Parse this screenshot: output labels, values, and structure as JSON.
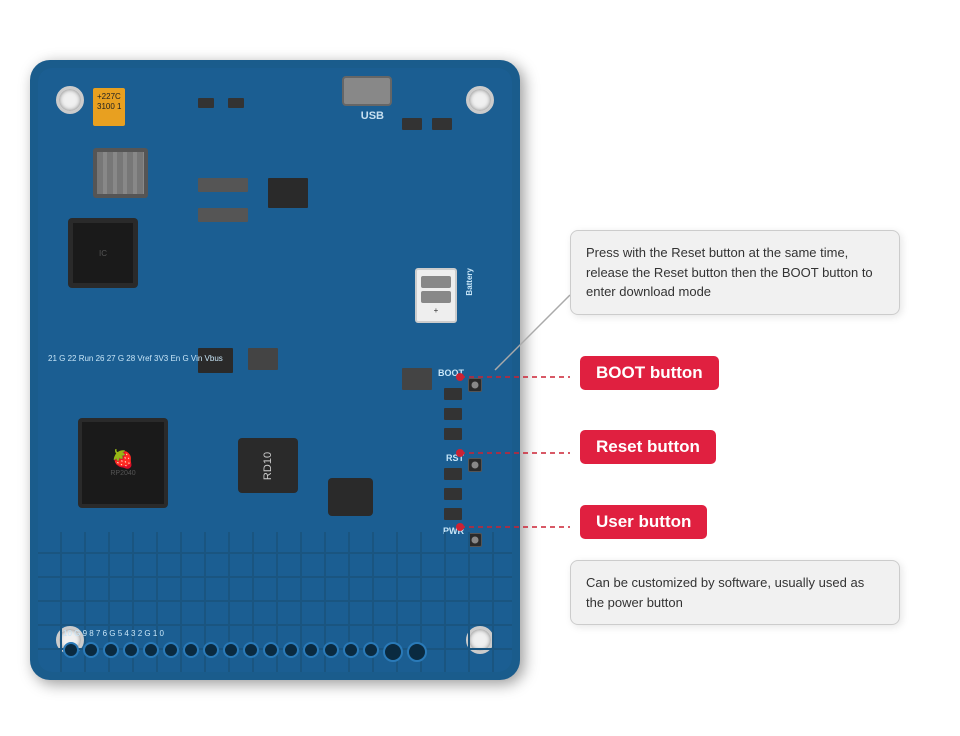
{
  "board": {
    "alt": "Microcontroller development board"
  },
  "labels": {
    "usb": "USB",
    "battery": "Battery",
    "boot": "BOOT",
    "rst": "RST",
    "pwr": "PWR",
    "bottom_pins": "10  G  9  8  7  6  G  5  4  3  2  G  1  0"
  },
  "callouts": {
    "top_callout": "Press with the Reset button at the same time, release the Reset button then the BOOT button to enter download mode",
    "bottom_callout": "Can be customized by software, usually used as the power button"
  },
  "buttons": {
    "boot": {
      "label": "BOOT button",
      "color": "#e02040"
    },
    "reset": {
      "label": "Reset button",
      "color": "#e02040"
    },
    "user": {
      "label": "User button",
      "color": "#e02040"
    }
  },
  "top_row_labels": "21  G  22  Run  26  27  G  28  Vref  3V3  En  G  Vin  Vbus"
}
